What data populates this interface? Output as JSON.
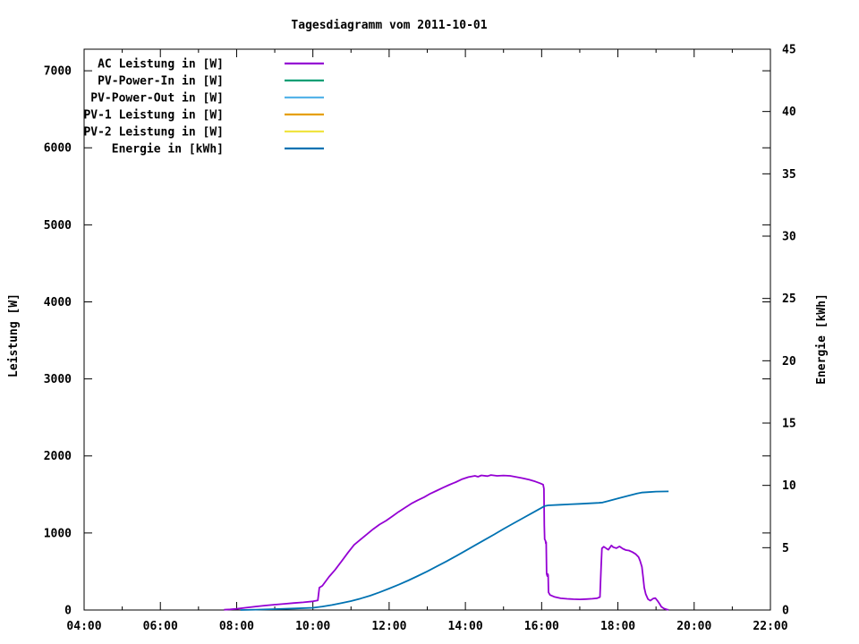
{
  "chart_data": {
    "type": "line",
    "title": "Tagesdiagramm vom 2011-10-01",
    "ylabel": "Leistung [W]",
    "y2label": "Energie [kWh]",
    "xlim": [
      4,
      22
    ],
    "ylim": [
      0,
      7280
    ],
    "y2lim": [
      0,
      45
    ],
    "x_major_ticks": [
      4,
      6,
      8,
      10,
      12,
      14,
      16,
      18,
      20,
      22
    ],
    "x_tick_labels": [
      "04:00",
      "06:00",
      "08:00",
      "10:00",
      "12:00",
      "14:00",
      "16:00",
      "18:00",
      "20:00",
      "22:00"
    ],
    "x_minor_step": 1,
    "y_ticks": [
      0,
      1000,
      2000,
      3000,
      4000,
      5000,
      6000,
      7000
    ],
    "y_tick_labels": [
      "0",
      "1000",
      "2000",
      "3000",
      "4000",
      "5000",
      "6000",
      "7000"
    ],
    "y2_ticks": [
      0,
      5,
      10,
      15,
      20,
      25,
      30,
      35,
      40,
      45
    ],
    "y2_tick_labels": [
      "0",
      "5",
      "10",
      "15",
      "20",
      "25",
      "30",
      "35",
      "40",
      "45"
    ],
    "grid": false,
    "legend_position": "top-left-inside",
    "background_color": "#ffffff",
    "axis_color": "#000000",
    "legend": [
      {
        "label": "AC Leistung in [W]",
        "color": "#9400d3"
      },
      {
        "label": "PV-Power-In in [W]",
        "color": "#009e73"
      },
      {
        "label": "PV-Power-Out in [W]",
        "color": "#56b4e9"
      },
      {
        "label": "PV-1 Leistung in [W]",
        "color": "#e69f00"
      },
      {
        "label": "PV-2 Leistung in [W]",
        "color": "#f0e442"
      },
      {
        "label": "Energie in [kWh]",
        "color": "#0072b2"
      }
    ],
    "series": [
      {
        "name": "AC Leistung in [W]",
        "color": "#9400d3",
        "axis": "y1",
        "points": [
          [
            7.67,
            3
          ],
          [
            7.83,
            8
          ],
          [
            8.0,
            15
          ],
          [
            8.25,
            30
          ],
          [
            8.5,
            45
          ],
          [
            8.75,
            58
          ],
          [
            9.0,
            70
          ],
          [
            9.25,
            80
          ],
          [
            9.5,
            90
          ],
          [
            9.75,
            100
          ],
          [
            10.0,
            113
          ],
          [
            10.13,
            125
          ],
          [
            10.17,
            290
          ],
          [
            10.25,
            315
          ],
          [
            10.42,
            430
          ],
          [
            10.58,
            520
          ],
          [
            10.75,
            630
          ],
          [
            10.92,
            745
          ],
          [
            11.08,
            845
          ],
          [
            11.25,
            915
          ],
          [
            11.42,
            985
          ],
          [
            11.58,
            1050
          ],
          [
            11.75,
            1110
          ],
          [
            11.92,
            1160
          ],
          [
            12.08,
            1215
          ],
          [
            12.25,
            1275
          ],
          [
            12.42,
            1330
          ],
          [
            12.58,
            1380
          ],
          [
            12.75,
            1425
          ],
          [
            12.92,
            1465
          ],
          [
            13.08,
            1510
          ],
          [
            13.25,
            1550
          ],
          [
            13.42,
            1590
          ],
          [
            13.58,
            1625
          ],
          [
            13.75,
            1660
          ],
          [
            13.92,
            1700
          ],
          [
            14.08,
            1725
          ],
          [
            14.25,
            1742
          ],
          [
            14.33,
            1730
          ],
          [
            14.42,
            1748
          ],
          [
            14.58,
            1738
          ],
          [
            14.67,
            1752
          ],
          [
            14.83,
            1742
          ],
          [
            15.0,
            1746
          ],
          [
            15.17,
            1742
          ],
          [
            15.33,
            1728
          ],
          [
            15.5,
            1712
          ],
          [
            15.67,
            1692
          ],
          [
            15.83,
            1668
          ],
          [
            15.96,
            1645
          ],
          [
            16.04,
            1628
          ],
          [
            16.06,
            1575
          ],
          [
            16.07,
            1100
          ],
          [
            16.08,
            920
          ],
          [
            16.1,
            900
          ],
          [
            16.11,
            865
          ],
          [
            16.12,
            880
          ],
          [
            16.13,
            470
          ],
          [
            16.15,
            440
          ],
          [
            16.16,
            468
          ],
          [
            16.17,
            452
          ],
          [
            16.18,
            230
          ],
          [
            16.22,
            195
          ],
          [
            16.33,
            172
          ],
          [
            16.5,
            152
          ],
          [
            16.67,
            145
          ],
          [
            16.83,
            140
          ],
          [
            17.0,
            138
          ],
          [
            17.17,
            142
          ],
          [
            17.33,
            146
          ],
          [
            17.45,
            152
          ],
          [
            17.53,
            168
          ],
          [
            17.56,
            560
          ],
          [
            17.58,
            800
          ],
          [
            17.63,
            822
          ],
          [
            17.7,
            798
          ],
          [
            17.75,
            783
          ],
          [
            17.83,
            838
          ],
          [
            17.88,
            815
          ],
          [
            17.96,
            802
          ],
          [
            18.04,
            825
          ],
          [
            18.13,
            795
          ],
          [
            18.21,
            778
          ],
          [
            18.29,
            772
          ],
          [
            18.38,
            752
          ],
          [
            18.46,
            728
          ],
          [
            18.54,
            688
          ],
          [
            18.58,
            640
          ],
          [
            18.63,
            560
          ],
          [
            18.66,
            430
          ],
          [
            18.69,
            290
          ],
          [
            18.73,
            205
          ],
          [
            18.79,
            140
          ],
          [
            18.85,
            122
          ],
          [
            18.92,
            148
          ],
          [
            18.98,
            156
          ],
          [
            19.04,
            118
          ],
          [
            19.09,
            82
          ],
          [
            19.14,
            42
          ],
          [
            19.21,
            18
          ],
          [
            19.29,
            6
          ],
          [
            19.33,
            3
          ]
        ]
      },
      {
        "name": "PV-Power-In in [W]",
        "color": "#009e73",
        "axis": "y1",
        "points": []
      },
      {
        "name": "PV-Power-Out in [W]",
        "color": "#56b4e9",
        "axis": "y1",
        "points": []
      },
      {
        "name": "PV-1 Leistung in [W]",
        "color": "#e69f00",
        "axis": "y1",
        "points": []
      },
      {
        "name": "PV-2 Leistung in [W]",
        "color": "#f0e442",
        "axis": "y1",
        "points": []
      },
      {
        "name": "Energie in [kWh]",
        "color": "#0072b2",
        "axis": "y2",
        "points": [
          [
            8.1,
            0.0
          ],
          [
            8.5,
            0.03
          ],
          [
            9.0,
            0.07
          ],
          [
            9.5,
            0.12
          ],
          [
            10.0,
            0.18
          ],
          [
            10.25,
            0.28
          ],
          [
            10.5,
            0.4
          ],
          [
            10.75,
            0.55
          ],
          [
            11.0,
            0.72
          ],
          [
            11.25,
            0.92
          ],
          [
            11.5,
            1.15
          ],
          [
            11.75,
            1.42
          ],
          [
            12.0,
            1.72
          ],
          [
            12.25,
            2.03
          ],
          [
            12.5,
            2.37
          ],
          [
            12.75,
            2.73
          ],
          [
            13.0,
            3.1
          ],
          [
            13.25,
            3.5
          ],
          [
            13.5,
            3.9
          ],
          [
            13.75,
            4.32
          ],
          [
            14.0,
            4.75
          ],
          [
            14.25,
            5.19
          ],
          [
            14.5,
            5.62
          ],
          [
            14.75,
            6.06
          ],
          [
            15.0,
            6.5
          ],
          [
            15.25,
            6.93
          ],
          [
            15.5,
            7.36
          ],
          [
            15.75,
            7.78
          ],
          [
            16.0,
            8.2
          ],
          [
            16.08,
            8.35
          ],
          [
            16.17,
            8.4
          ],
          [
            16.5,
            8.45
          ],
          [
            17.0,
            8.52
          ],
          [
            17.5,
            8.6
          ],
          [
            17.6,
            8.63
          ],
          [
            17.75,
            8.75
          ],
          [
            18.0,
            8.95
          ],
          [
            18.25,
            9.15
          ],
          [
            18.5,
            9.35
          ],
          [
            18.62,
            9.42
          ],
          [
            18.8,
            9.46
          ],
          [
            19.0,
            9.5
          ],
          [
            19.33,
            9.52
          ]
        ]
      }
    ]
  }
}
